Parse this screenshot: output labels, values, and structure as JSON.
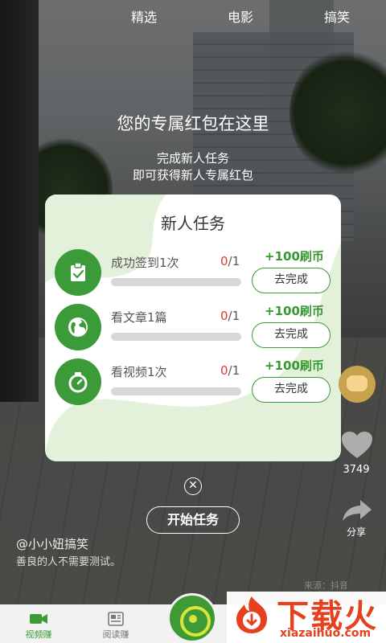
{
  "top_tabs": [
    "精选",
    "电影",
    "搞笑"
  ],
  "promo": {
    "title": "您的专属红包在这里",
    "line1": "完成新人任务",
    "line2": "即可获得新人专属红包"
  },
  "card": {
    "title": "新人任务",
    "tasks": [
      {
        "icon": "clipboard-check-icon",
        "name": "成功签到1次",
        "done": "0",
        "total": "/1",
        "progress": 0,
        "reward": "+100刷币",
        "button": "去完成"
      },
      {
        "icon": "globe-icon",
        "name": "看文章1篇",
        "done": "0",
        "total": "/1",
        "progress": 0,
        "reward": "+100刷币",
        "button": "去完成"
      },
      {
        "icon": "stopwatch-icon",
        "name": "看视频1次",
        "done": "0",
        "total": "/1",
        "progress": 0,
        "reward": "+100刷币",
        "button": "去完成"
      }
    ]
  },
  "close_symbol": "✕",
  "start_button": "开始任务",
  "side": {
    "like_count": "3749",
    "share_label": "分享"
  },
  "video": {
    "author": "@小小妞搞笑",
    "caption": "善良的人不需要测试。",
    "watermark": "来源：抖音"
  },
  "bottom_nav": {
    "items": [
      {
        "label": "视频赚",
        "icon": "video-icon",
        "active": true
      },
      {
        "label": "阅读赚",
        "icon": "newspaper-icon",
        "active": false
      }
    ],
    "center_icon": "target-icon"
  },
  "brand": {
    "name": "下载火",
    "domain": "xiazaihuo.com"
  },
  "colors": {
    "accent_green": "#3a9b38",
    "progress_red": "#e2372f",
    "brand_orange": "#e5411f"
  }
}
